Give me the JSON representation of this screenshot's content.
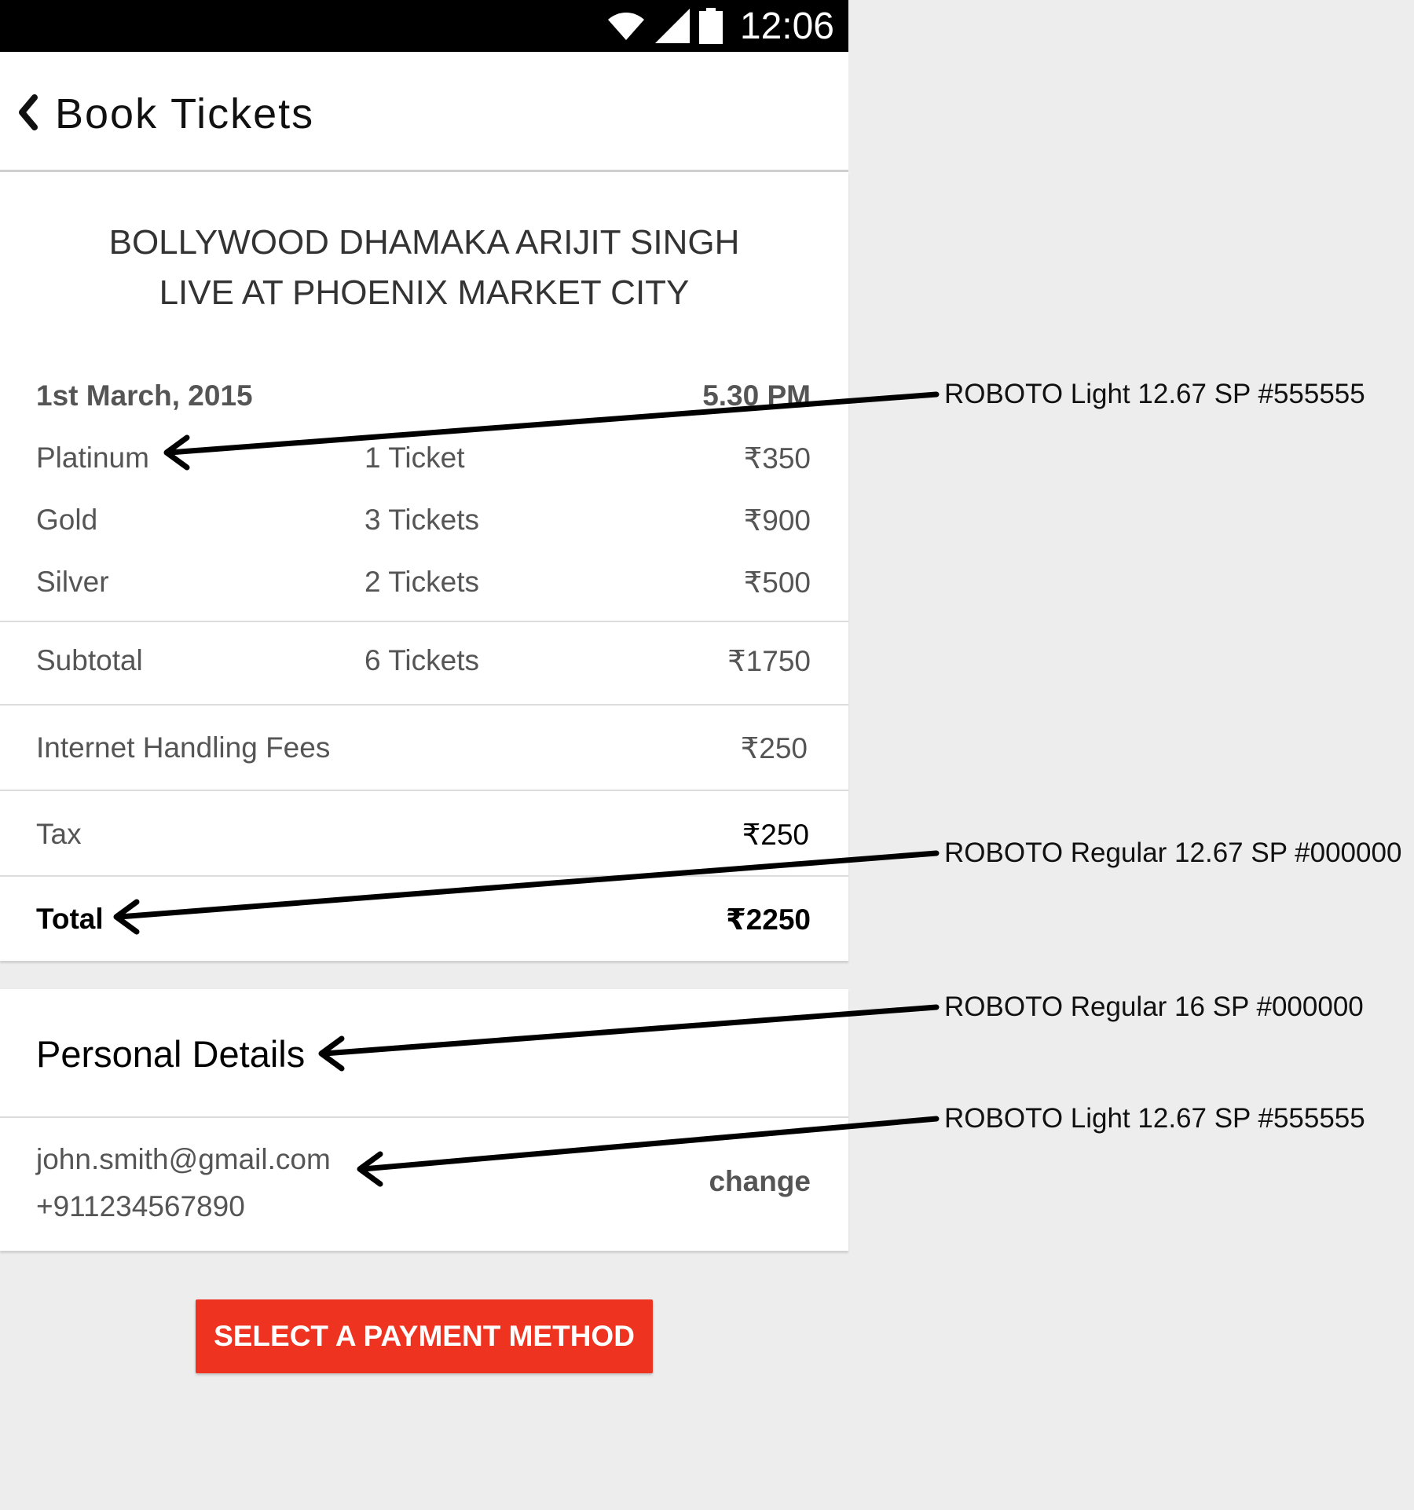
{
  "status_bar": {
    "time": "12:06"
  },
  "app_bar": {
    "title": "Book Tickets",
    "back_icon": "chevron-left-icon"
  },
  "event": {
    "title_line1": "BOLLYWOOD DHAMAKA ARIJIT SINGH",
    "title_line2": "LIVE AT PHOENIX MARKET CITY",
    "date": "1st March, 2015",
    "time": "5.30 PM"
  },
  "tickets": [
    {
      "category": "Platinum",
      "count": "1 Ticket",
      "price": "₹350"
    },
    {
      "category": "Gold",
      "count": "3 Tickets",
      "price": "₹900"
    },
    {
      "category": "Silver",
      "count": "2 Tickets",
      "price": "₹500"
    }
  ],
  "subtotal": {
    "label": "Subtotal",
    "count": "6 Tickets",
    "price": "₹1750"
  },
  "fees": {
    "label": "Internet Handling Fees",
    "price": "₹250"
  },
  "tax": {
    "label": "Tax",
    "price": "₹250"
  },
  "total": {
    "label": "Total",
    "price": "₹2250"
  },
  "personal_details": {
    "title": "Personal Details",
    "email": "john.smith@gmail.com",
    "phone": "+911234567890",
    "change_label": "change"
  },
  "payment_button": {
    "label": "SELECT A PAYMENT METHOD"
  },
  "annotations": [
    "ROBOTO Light 12.67 SP #555555",
    "ROBOTO Regular 12.67 SP #000000",
    "ROBOTO Regular 16 SP #000000",
    "ROBOTO Light 12.67 SP #555555"
  ],
  "colors": {
    "status_bar": "#000000",
    "accent_button": "#ee3320",
    "secondary_text": "#555555",
    "primary_text": "#000000",
    "background": "#ededed"
  }
}
